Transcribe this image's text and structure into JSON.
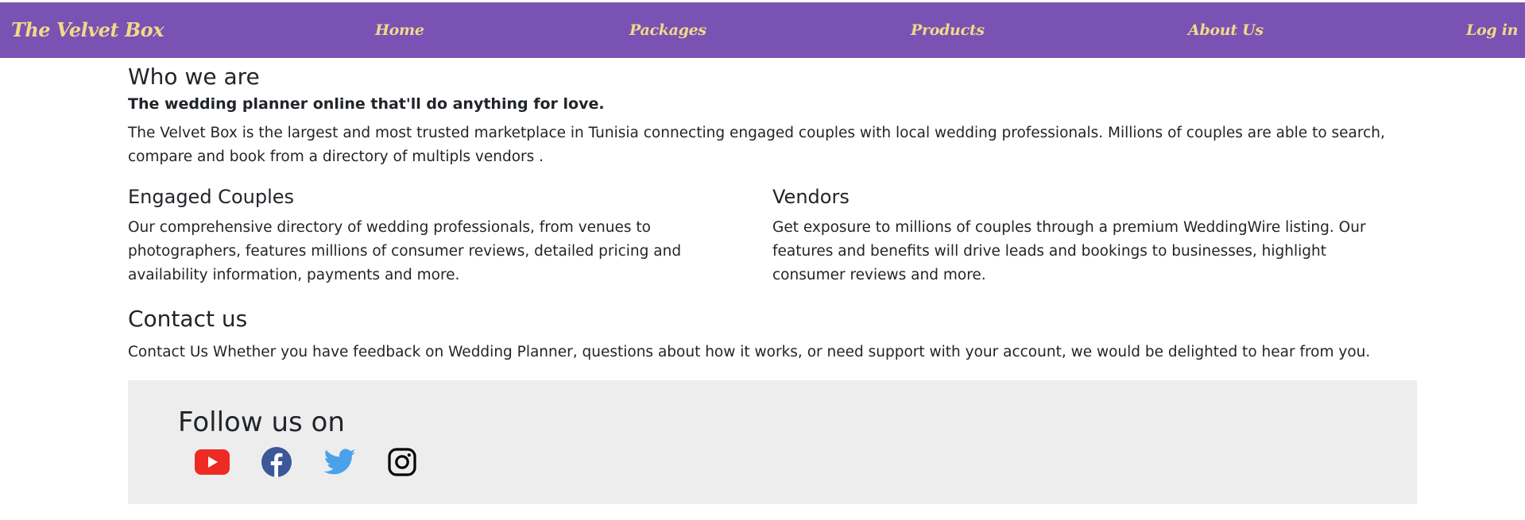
{
  "nav": {
    "brand": "The Velvet Box",
    "links": [
      "Home",
      "Packages",
      "Products",
      "About Us",
      "Log in"
    ]
  },
  "who": {
    "heading": "Who we are",
    "tagline": "The wedding planner online that'll do anything for love.",
    "description": "The Velvet Box is the largest and most trusted marketplace in Tunisia connecting engaged couples with local wedding professionals. Millions of couples are able to search, compare and book from a directory of multipls vendors ."
  },
  "couples": {
    "heading": "Engaged Couples",
    "text": "Our comprehensive directory of wedding professionals, from venues to photographers, features millions of consumer reviews, detailed pricing and availability information, payments and more."
  },
  "vendors": {
    "heading": "Vendors",
    "text": "Get exposure to millions of couples through a premium WeddingWire listing. Our features and benefits will drive leads and bookings to businesses, highlight consumer reviews and more."
  },
  "contact": {
    "heading": "Contact us",
    "text": "Contact Us Whether you have feedback on Wedding Planner, questions about how it works, or need support with your account, we would be delighted to hear from you."
  },
  "follow": {
    "heading": "Follow us on",
    "icons": [
      "youtube-icon",
      "facebook-icon",
      "twitter-icon",
      "instagram-icon"
    ]
  },
  "colors": {
    "navbar": "#7952b3",
    "nav_text": "#f2d88a",
    "follow_bg": "#ededed",
    "youtube": "#ee2a24",
    "facebook": "#3b5998",
    "twitter": "#4aa1eb",
    "instagram": "#000000"
  }
}
